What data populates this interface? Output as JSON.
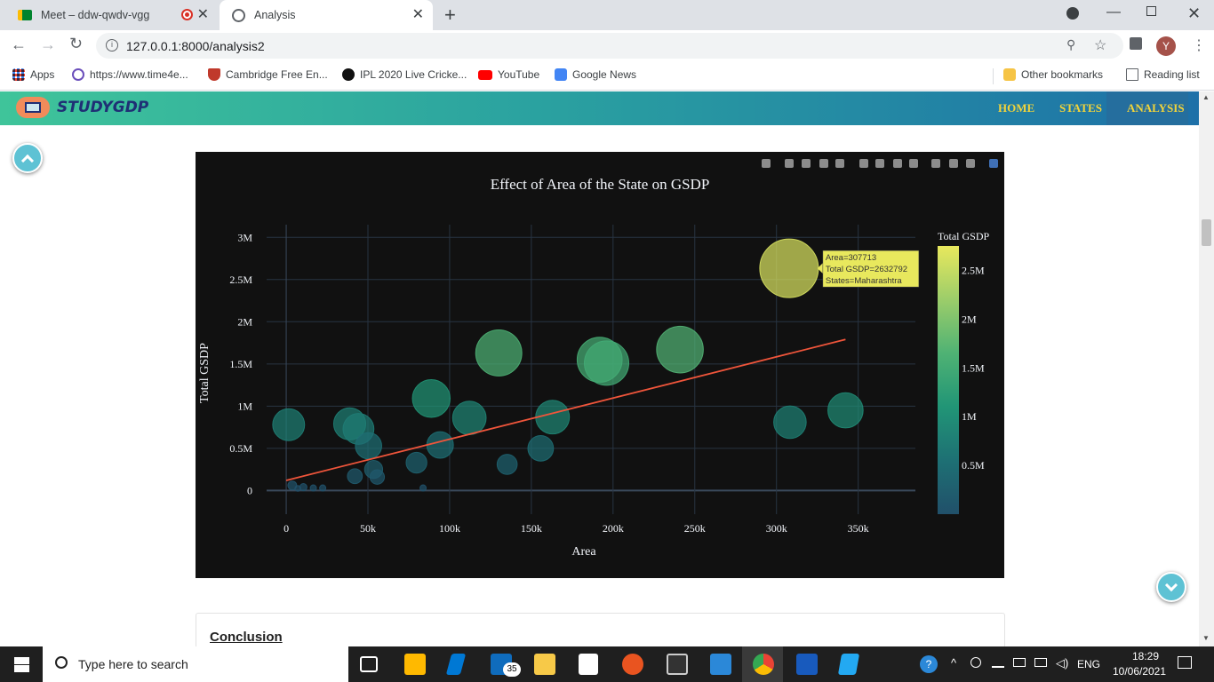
{
  "browser": {
    "tabs": [
      {
        "title": "Meet – ddw-qwdv-vgg",
        "recording": true
      },
      {
        "title": "Analysis",
        "active": true
      }
    ],
    "url": "127.0.0.1:8000/analysis2",
    "profile_initial": "Y",
    "bookmarks": [
      {
        "label": "Apps",
        "icon": "apps-grid-icon"
      },
      {
        "label": "https://www.time4e...",
        "icon": "globe-icon"
      },
      {
        "label": "Cambridge Free En...",
        "icon": "shield-icon"
      },
      {
        "label": "IPL 2020 Live Cricke...",
        "icon": "cricket-icon"
      },
      {
        "label": "YouTube",
        "icon": "youtube-icon"
      },
      {
        "label": "Google News",
        "icon": "news-icon"
      }
    ],
    "other_bookmarks": "Other bookmarks",
    "reading_list": "Reading list"
  },
  "site": {
    "logo": "STUDYGDP",
    "nav": [
      "HOME",
      "STATES",
      "ANALYSIS"
    ],
    "active_nav": "ANALYSIS",
    "conclusion_title": "Conclusion"
  },
  "chart_data": {
    "type": "scatter",
    "title": "Effect of Area of the State on GSDP",
    "xlabel": "Area",
    "ylabel": "Total GSDP",
    "xlim": [
      -12000,
      385000
    ],
    "ylim": [
      -280000,
      3150000
    ],
    "xticks": [
      0,
      50000,
      100000,
      150000,
      200000,
      250000,
      300000,
      350000
    ],
    "xtick_labels": [
      "0",
      "50k",
      "100k",
      "150k",
      "200k",
      "250k",
      "300k",
      "350k"
    ],
    "yticks": [
      0,
      500000,
      1000000,
      1500000,
      2000000,
      2500000,
      3000000
    ],
    "ytick_labels": [
      "0",
      "0.5M",
      "1M",
      "1.5M",
      "2M",
      "2.5M",
      "3M"
    ],
    "colorbar": {
      "title": "Total GSDP",
      "range": [
        0,
        2750000
      ],
      "ticks": [
        500000,
        1000000,
        1500000,
        2000000,
        2500000
      ],
      "tick_labels": [
        "0.5M",
        "1M",
        "1.5M",
        "2M",
        "2.5M"
      ]
    },
    "size_encoding": "Total GSDP",
    "points": [
      {
        "x": 307713,
        "y": 2632792
      },
      {
        "x": 342239,
        "y": 950000
      },
      {
        "x": 308252,
        "y": 810000
      },
      {
        "x": 240928,
        "y": 1670000
      },
      {
        "x": 196024,
        "y": 1510000
      },
      {
        "x": 191791,
        "y": 1550000
      },
      {
        "x": 130060,
        "y": 1630000
      },
      {
        "x": 162968,
        "y": 870000
      },
      {
        "x": 155707,
        "y": 500000
      },
      {
        "x": 135191,
        "y": 310000
      },
      {
        "x": 112077,
        "y": 860000
      },
      {
        "x": 88752,
        "y": 1090000
      },
      {
        "x": 94163,
        "y": 540000
      },
      {
        "x": 79716,
        "y": 330000
      },
      {
        "x": 83743,
        "y": 30000
      },
      {
        "x": 50362,
        "y": 530000
      },
      {
        "x": 44212,
        "y": 730000
      },
      {
        "x": 38852,
        "y": 790000
      },
      {
        "x": 53483,
        "y": 250000
      },
      {
        "x": 55673,
        "y": 160000
      },
      {
        "x": 42000,
        "y": 170000
      },
      {
        "x": 22327,
        "y": 30000
      },
      {
        "x": 16579,
        "y": 30000
      },
      {
        "x": 10486,
        "y": 40000
      },
      {
        "x": 7096,
        "y": 25000
      },
      {
        "x": 3702,
        "y": 60000
      },
      {
        "x": 1484,
        "y": 780000
      }
    ],
    "trendline": {
      "x": [
        0,
        342239
      ],
      "y": [
        120000,
        1790000
      ]
    },
    "hover": {
      "lines": [
        "Area=307713",
        "Total GSDP=2632792",
        "States=Maharashtra"
      ]
    },
    "colors": {
      "background": "#111111",
      "grid": "#283442",
      "trendline": "#ef553b"
    }
  },
  "taskbar": {
    "search_placeholder": "Type here to search",
    "language": "ENG",
    "time": "18:29",
    "date": "10/06/2021",
    "mail_badge": "35"
  }
}
